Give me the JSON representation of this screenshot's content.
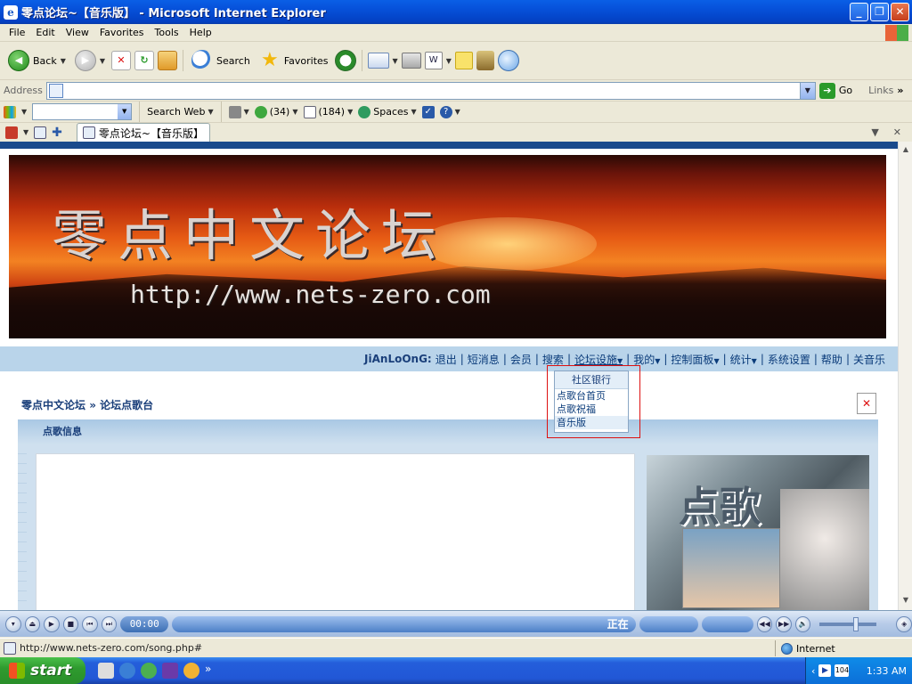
{
  "window": {
    "title": "零点论坛~【音乐版】 - Microsoft Internet Explorer"
  },
  "menu": [
    "File",
    "Edit",
    "View",
    "Favorites",
    "Tools",
    "Help"
  ],
  "toolbar": {
    "back": "Back",
    "search": "Search",
    "favorites": "Favorites"
  },
  "address": {
    "label": "Address",
    "value": "",
    "go": "Go",
    "links": "Links"
  },
  "live": {
    "search_web": "Search Web",
    "contacts_count": "(34)",
    "mail_count": "(184)",
    "spaces": "Spaces"
  },
  "tab": {
    "title": "零点论坛~【音乐版】"
  },
  "banner": {
    "title": "零点中文论坛",
    "url": "http://www.nets-zero.com"
  },
  "nav": {
    "user": "JiAnLoOnG:",
    "items": [
      "退出",
      "短消息",
      "会员",
      "搜索",
      "论坛设施",
      "我的",
      "控制面板",
      "统计",
      "系统设置",
      "帮助",
      "关音乐"
    ]
  },
  "breadcrumb": {
    "home": "零点中文论坛",
    "sep": "»",
    "current": "论坛点歌台"
  },
  "panel": {
    "header": "点歌信息",
    "image_text": "点歌"
  },
  "popup": {
    "header": "社区银行",
    "items": [
      "点歌台首页",
      "点歌祝福",
      "音乐版"
    ]
  },
  "player": {
    "time": "00:00",
    "status": "正在"
  },
  "statusbar": {
    "url": "http://www.nets-zero.com/song.php#",
    "zone": "Internet"
  },
  "taskbar": {
    "start": "start",
    "clock": "1:33 AM",
    "tray_num": "104"
  }
}
